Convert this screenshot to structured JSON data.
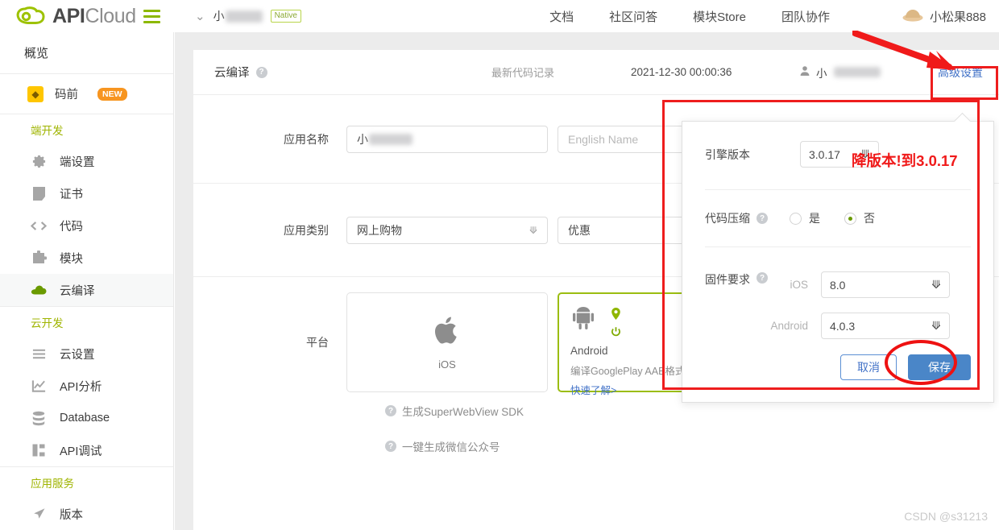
{
  "brand": {
    "api": "API",
    "cloud": "Cloud",
    "logo_icon": "cloud-logo-icon",
    "menu_icon": "hamburger-menu-icon"
  },
  "topbar": {
    "project_chevron_icon": "chevron-down-icon",
    "project_name": "小",
    "project_tag": "Native",
    "nav": [
      {
        "label": "文档",
        "name": "nav-docs"
      },
      {
        "label": "社区问答",
        "name": "nav-community"
      },
      {
        "label": "模块Store",
        "name": "nav-module-store"
      },
      {
        "label": "团队协作",
        "name": "nav-team"
      }
    ],
    "user_name": "小松果888",
    "user_avatar_icon": "cloud-avatar-icon"
  },
  "sidebar": {
    "overview": "概览",
    "maqian": {
      "label": "码前",
      "badge": "NEW",
      "icon": "maqian-icon"
    },
    "sections": [
      {
        "heading": "端开发",
        "items": [
          {
            "label": "端设置",
            "icon": "gear-icon",
            "active": false
          },
          {
            "label": "证书",
            "icon": "certificate-icon",
            "active": false
          },
          {
            "label": "代码",
            "icon": "code-icon",
            "active": false
          },
          {
            "label": "模块",
            "icon": "puzzle-icon",
            "active": false
          },
          {
            "label": "云编译",
            "icon": "cloud-icon",
            "active": true
          }
        ]
      },
      {
        "heading": "云开发",
        "items": [
          {
            "label": "云设置",
            "icon": "sliders-icon",
            "active": false
          },
          {
            "label": "API分析",
            "icon": "chart-icon",
            "active": false
          },
          {
            "label": "Database",
            "icon": "database-icon",
            "active": false
          },
          {
            "label": "API调试",
            "icon": "api-debug-icon",
            "active": false
          }
        ]
      },
      {
        "heading": "应用服务",
        "items": [
          {
            "label": "版本",
            "icon": "rocket-icon",
            "active": false
          }
        ]
      }
    ]
  },
  "card": {
    "header": {
      "title": "云编译",
      "help_icon": "question-mark-icon",
      "latest_record_label": "最新代码记录",
      "date": "2021-12-30 00:00:36",
      "user_icon": "person-icon",
      "user_name": "小",
      "advanced_settings": "高级设置"
    },
    "rows": [
      {
        "label": "应用名称",
        "value": "小",
        "placeholder_en": "English Name"
      },
      {
        "label": "应用类别",
        "value": "网上购物",
        "second_value": "优惠"
      }
    ],
    "platform": {
      "label": "平台",
      "ios": {
        "icon": "apple-icon",
        "label": "iOS"
      },
      "android": {
        "icon": "android-robot-icon",
        "label": "Android",
        "pin_icon": "location-pin-icon",
        "power_icon": "power-icon",
        "aab_text": "编译GooglePlay AAB格式",
        "learn_link": "快速了解>",
        "toggle_on": false
      }
    },
    "bottom_links": [
      {
        "label": "生成SuperWebView SDK",
        "icon": "question-mark-icon"
      },
      {
        "label": "一键生成微信公众号",
        "icon": "question-mark-icon"
      }
    ]
  },
  "popup": {
    "engine": {
      "label": "引擎版本",
      "value": "3.0.17",
      "chevron_icon": "chevron-down-icon"
    },
    "compress": {
      "label": "代码压缩",
      "help_icon": "question-mark-icon",
      "yes": "是",
      "no": "否",
      "selected": "否"
    },
    "firmware": {
      "label": "固件要求",
      "help_icon": "question-mark-icon",
      "ios": {
        "label": "iOS",
        "value": "8.0",
        "chevron_icon": "chevron-down-icon"
      },
      "android": {
        "label": "Android",
        "value": "4.0.3",
        "chevron_icon": "chevron-down-icon"
      }
    },
    "cancel": "取消",
    "save": "保存"
  },
  "annotations": {
    "red_note": "降版本!到3.0.17",
    "arrow_icon": "red-arrow-icon",
    "highlight_color": "#ee1d1d"
  },
  "watermark": "CSDN @s31213"
}
